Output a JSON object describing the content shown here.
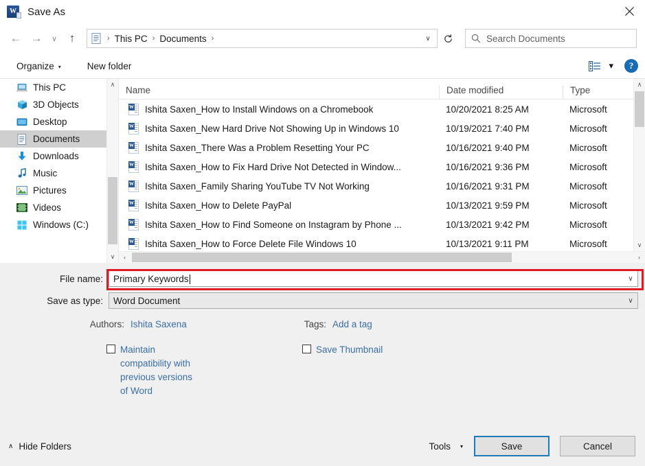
{
  "window": {
    "title": "Save As",
    "app_icon": "word-icon",
    "close_label": "✕"
  },
  "navigation": {
    "back": "←",
    "forward": "→",
    "recent": "∨",
    "up": "↑",
    "refresh": "↻",
    "breadcrumbs": [
      "This PC",
      "Documents"
    ],
    "separator": "›",
    "dropdown": "∨"
  },
  "search": {
    "placeholder": "Search Documents",
    "icon": "search-icon"
  },
  "command_bar": {
    "organize": "Organize",
    "organize_caret": "▾",
    "new_folder": "New folder",
    "view_caret": "▾",
    "help": "?"
  },
  "sidebar": {
    "items": [
      {
        "label": "This PC",
        "icon": "pc-icon",
        "selected": false
      },
      {
        "label": "3D Objects",
        "icon": "cube-icon",
        "selected": false
      },
      {
        "label": "Desktop",
        "icon": "desktop-icon",
        "selected": false
      },
      {
        "label": "Documents",
        "icon": "documents-icon",
        "selected": true
      },
      {
        "label": "Downloads",
        "icon": "download-icon",
        "selected": false
      },
      {
        "label": "Music",
        "icon": "music-icon",
        "selected": false
      },
      {
        "label": "Pictures",
        "icon": "pictures-icon",
        "selected": false
      },
      {
        "label": "Videos",
        "icon": "video-icon",
        "selected": false
      },
      {
        "label": "Windows (C:)",
        "icon": "drive-icon",
        "selected": false
      }
    ],
    "scroll_up": "∧",
    "scroll_down": "∨"
  },
  "file_list": {
    "columns": [
      "Name",
      "Date modified",
      "Type"
    ],
    "sort_indicator": "⌄",
    "rows": [
      {
        "name": "Ishita Saxen_How to Install Windows on a Chromebook",
        "date": "10/20/2021 8:25 AM",
        "type": "Microsoft"
      },
      {
        "name": "Ishita Saxen_New Hard Drive Not Showing Up in Windows 10",
        "date": "10/19/2021 7:40 PM",
        "type": "Microsoft"
      },
      {
        "name": "Ishita Saxen_There Was a Problem Resetting Your PC",
        "date": "10/16/2021 9:40 PM",
        "type": "Microsoft"
      },
      {
        "name": "Ishita Saxen_How to Fix Hard Drive Not Detected in Window...",
        "date": "10/16/2021 9:36 PM",
        "type": "Microsoft"
      },
      {
        "name": "Ishita Saxen_Family Sharing YouTube TV Not Working",
        "date": "10/16/2021 9:31 PM",
        "type": "Microsoft"
      },
      {
        "name": "Ishita Saxen_How to Delete PayPal",
        "date": "10/13/2021 9:59 PM",
        "type": "Microsoft"
      },
      {
        "name": "Ishita Saxen_How to Find Someone on Instagram by Phone ...",
        "date": "10/13/2021 9:42 PM",
        "type": "Microsoft"
      },
      {
        "name": "Ishita Saxen_How to Force Delete File Windows 10",
        "date": "10/13/2021 9:11 PM",
        "type": "Microsoft"
      }
    ],
    "hscroll_left": "‹",
    "hscroll_right": "›",
    "vscroll_up": "∧",
    "vscroll_down": "∨"
  },
  "form": {
    "file_name_label": "File name:",
    "file_name_value": "Primary Keywords",
    "file_name_highlight_color": "#e01b24",
    "save_as_type_label": "Save as type:",
    "save_as_type_value": "Word Document",
    "combo_arrow": "∨",
    "authors_label": "Authors:",
    "authors_value": "Ishita Saxena",
    "tags_label": "Tags:",
    "tags_value": "Add a tag",
    "maintain_compat_label": "Maintain compatibility with previous versions of Word",
    "maintain_compat_checked": false,
    "save_thumbnail_label": "Save Thumbnail",
    "save_thumbnail_checked": false,
    "link_color": "#3a6ea5"
  },
  "footer": {
    "hide_folders": "Hide Folders",
    "hide_folders_caret": "∧",
    "tools": "Tools",
    "tools_caret": "▾",
    "save": "Save",
    "cancel": "Cancel",
    "focus_color": "#1f7bb6"
  }
}
